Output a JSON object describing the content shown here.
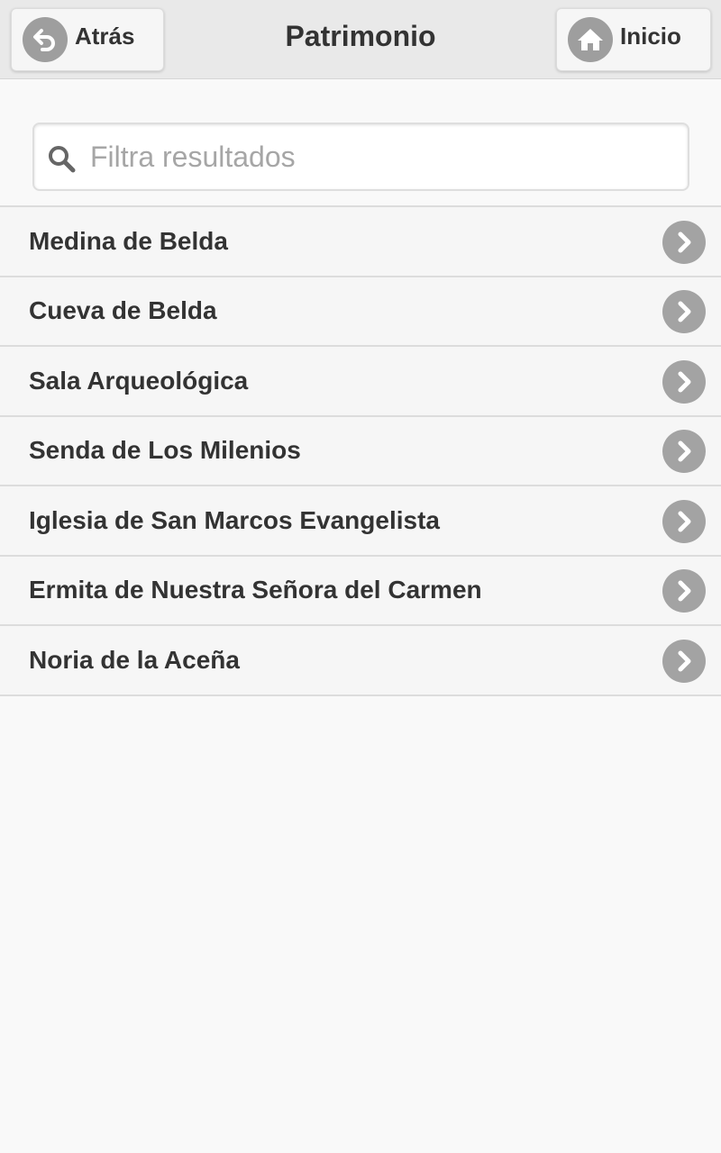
{
  "header": {
    "back_label": "Atrás",
    "title": "Patrimonio",
    "home_label": "Inicio"
  },
  "search": {
    "placeholder": "Filtra resultados",
    "value": ""
  },
  "items": [
    {
      "label": "Medina de Belda"
    },
    {
      "label": "Cueva de Belda"
    },
    {
      "label": "Sala Arqueológica"
    },
    {
      "label": "Senda de Los Milenios"
    },
    {
      "label": "Iglesia de San Marcos Evangelista"
    },
    {
      "label": "Ermita de Nuestra Señora del Carmen"
    },
    {
      "label": "Noria de la Aceña"
    }
  ],
  "colors": {
    "header_bg": "#e9e9e9",
    "icon_bg": "#9e9e9e",
    "text": "#333333",
    "row_bg": "#f6f6f6"
  }
}
